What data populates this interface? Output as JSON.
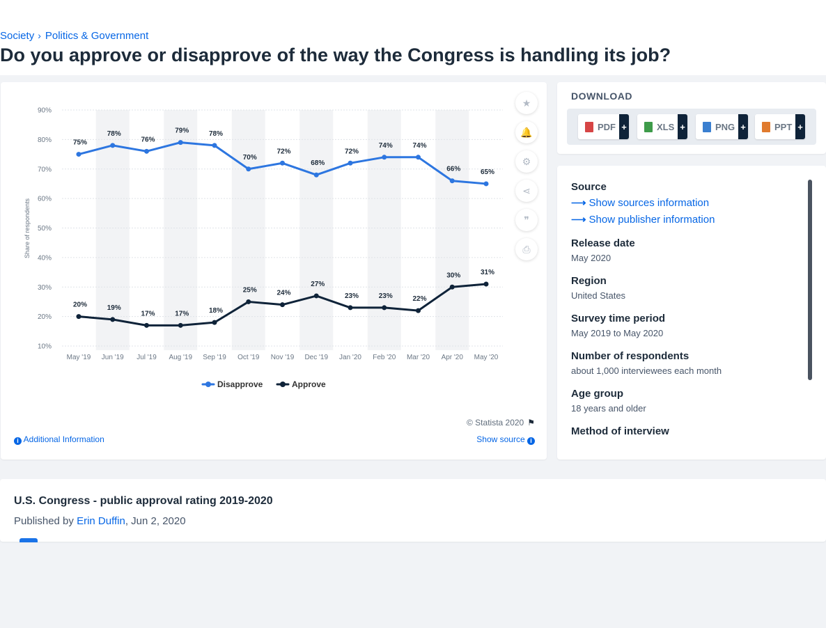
{
  "breadcrumb": {
    "level1": "Society",
    "separator": "›",
    "level2": "Politics & Government"
  },
  "page_title": "Do you approve or disapprove of the way the Congress is handling its job?",
  "chart_data": {
    "type": "line",
    "categories": [
      "May '19",
      "Jun '19",
      "Jul '19",
      "Aug '19",
      "Sep '19",
      "Oct '19",
      "Nov '19",
      "Dec '19",
      "Jan '20",
      "Feb '20",
      "Mar '20",
      "Apr '20",
      "May '20"
    ],
    "series": [
      {
        "name": "Disapprove",
        "color": "#2d76e0",
        "values": [
          75,
          78,
          76,
          79,
          78,
          70,
          72,
          68,
          72,
          74,
          74,
          66,
          65
        ]
      },
      {
        "name": "Approve",
        "color": "#0f2339",
        "values": [
          20,
          19,
          17,
          17,
          18,
          25,
          24,
          27,
          23,
          23,
          22,
          30,
          31
        ]
      }
    ],
    "ylabel": "Share of respondents",
    "xlabel": "",
    "yticks": [
      "90%",
      "80%",
      "70%",
      "60%",
      "50%",
      "40%",
      "30%",
      "20%",
      "10%"
    ],
    "ylim": [
      10,
      90
    ],
    "value_suffix": "%",
    "legend_position": "bottom",
    "grid": true,
    "alternating_column_shading": true
  },
  "chart_footer": {
    "copyright": "© Statista 2020",
    "additional_info": "Additional Information",
    "show_source": "Show source"
  },
  "actions": {
    "icons": [
      "star-icon",
      "bell-icon",
      "gear-icon",
      "share-icon",
      "quote-icon",
      "print-icon"
    ],
    "glyphs": [
      "★",
      "🔔",
      "⚙",
      "⋖",
      "❞",
      "⎙"
    ]
  },
  "download": {
    "title": "DOWNLOAD",
    "formats": [
      {
        "label": "PDF",
        "color": "#d64545",
        "plus": "+"
      },
      {
        "label": "XLS",
        "color": "#3e9b4a",
        "plus": "+"
      },
      {
        "label": "PNG",
        "color": "#3a7fd0",
        "plus": "+"
      },
      {
        "label": "PPT",
        "color": "#e07b2e",
        "plus": "+"
      }
    ]
  },
  "info": {
    "source_head": "Source",
    "links": [
      "Show sources information",
      "Show publisher information"
    ],
    "arrow": "⟶",
    "items": [
      {
        "head": "Release date",
        "value": "May 2020"
      },
      {
        "head": "Region",
        "value": "United States"
      },
      {
        "head": "Survey time period",
        "value": "May 2019 to May 2020"
      },
      {
        "head": "Number of respondents",
        "value": "about 1,000 interviewees each month"
      },
      {
        "head": "Age group",
        "value": "18 years and older"
      },
      {
        "head": "Method of interview",
        "value": ""
      }
    ]
  },
  "bottom": {
    "title": "U.S. Congress - public approval rating 2019-2020",
    "published_prefix": "Published by",
    "author": "Erin Duffin",
    "date": ", Jun 2, 2020"
  }
}
